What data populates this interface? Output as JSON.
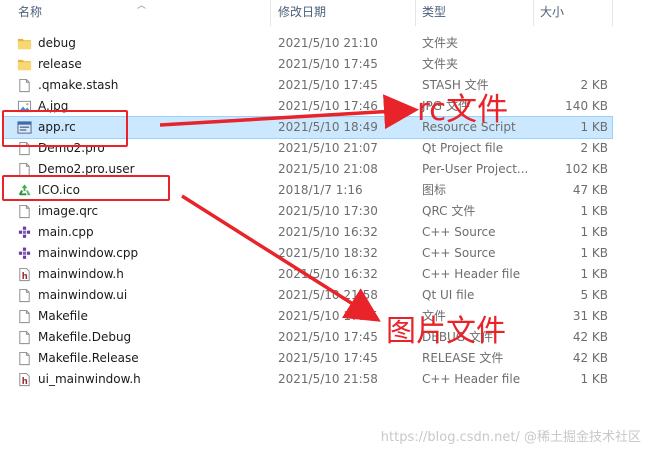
{
  "header": {
    "name": "名称",
    "date": "修改日期",
    "type": "类型",
    "size": "大小"
  },
  "files": [
    {
      "name": "debug",
      "date": "2021/5/10 21:10",
      "type": "文件夹",
      "size": "",
      "icon": "folder-icon"
    },
    {
      "name": "release",
      "date": "2021/5/10 17:45",
      "type": "文件夹",
      "size": "",
      "icon": "folder-icon"
    },
    {
      "name": ".qmake.stash",
      "date": "2021/5/10 17:45",
      "type": "STASH 文件",
      "size": "2 KB",
      "icon": "file-icon"
    },
    {
      "name": "A.jpg",
      "date": "2021/5/10 17:46",
      "type": "JPG 文件",
      "size": "140 KB",
      "icon": "image-file-icon"
    },
    {
      "name": "app.rc",
      "date": "2021/5/10 18:49",
      "type": "Resource Script",
      "size": "1 KB",
      "icon": "resource-script-icon",
      "selected": true
    },
    {
      "name": "Demo2.pro",
      "date": "2021/5/10 21:07",
      "type": "Qt Project file",
      "size": "2 KB",
      "icon": "file-icon"
    },
    {
      "name": "Demo2.pro.user",
      "date": "2021/5/10 21:08",
      "type": "Per-User Project...",
      "size": "102 KB",
      "icon": "file-icon"
    },
    {
      "name": "ICO.ico",
      "date": "2018/1/7 1:16",
      "type": "图标",
      "size": "47 KB",
      "icon": "recycle-ico-icon"
    },
    {
      "name": "image.qrc",
      "date": "2021/5/10 17:30",
      "type": "QRC 文件",
      "size": "1 KB",
      "icon": "file-icon"
    },
    {
      "name": "main.cpp",
      "date": "2021/5/10 16:32",
      "type": "C++ Source",
      "size": "1 KB",
      "icon": "cpp-source-icon"
    },
    {
      "name": "mainwindow.cpp",
      "date": "2021/5/10 18:32",
      "type": "C++ Source",
      "size": "1 KB",
      "icon": "cpp-source-icon"
    },
    {
      "name": "mainwindow.h",
      "date": "2021/5/10 16:32",
      "type": "C++ Header file",
      "size": "1 KB",
      "icon": "cpp-header-icon"
    },
    {
      "name": "mainwindow.ui",
      "date": "2021/5/10 21:58",
      "type": "Qt UI file",
      "size": "5 KB",
      "icon": "file-icon"
    },
    {
      "name": "Makefile",
      "date": "2021/5/10 17:45",
      "type": "文件",
      "size": "31 KB",
      "icon": "file-icon"
    },
    {
      "name": "Makefile.Debug",
      "date": "2021/5/10 17:45",
      "type": "DEBUG 文件",
      "size": "42 KB",
      "icon": "file-icon"
    },
    {
      "name": "Makefile.Release",
      "date": "2021/5/10 17:45",
      "type": "RELEASE 文件",
      "size": "42 KB",
      "icon": "file-icon"
    },
    {
      "name": "ui_mainwindow.h",
      "date": "2021/5/10 21:58",
      "type": "C++ Header file",
      "size": "1 KB",
      "icon": "cpp-header-icon"
    }
  ],
  "annotations": {
    "rc_label": "rc文件",
    "image_label": "图片文件"
  },
  "watermark": "https://blog.csdn.net/ @稀土掘金技术社区",
  "colors": {
    "annotation_red": "#e8232a",
    "selection_bg": "#cce8ff",
    "folder_yellow": "#f3c54b"
  }
}
